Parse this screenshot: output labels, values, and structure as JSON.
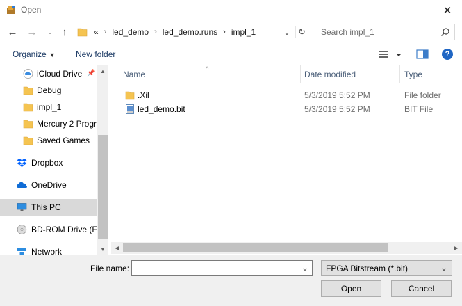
{
  "window": {
    "title": "Open",
    "close_glyph": "✕"
  },
  "nav": {
    "back_glyph": "←",
    "forward_glyph": "→",
    "recent_glyph": "⌄",
    "up_glyph": "↑"
  },
  "address": {
    "overflow": "«",
    "crumbs": [
      "led_demo",
      "led_demo.runs",
      "impl_1"
    ],
    "separator": "›",
    "dropdown_glyph": "⌄",
    "refresh_glyph": "↻"
  },
  "search": {
    "placeholder": "Search impl_1"
  },
  "toolbar": {
    "organize_label": "Organize",
    "organize_caret": "▼",
    "new_folder_label": "New folder",
    "help_glyph": "?"
  },
  "sidebar": {
    "items": [
      {
        "label": "iCloud Drive",
        "icon": "icloud-icon",
        "pinned": true
      },
      {
        "label": "Debug",
        "icon": "folder-icon"
      },
      {
        "label": "impl_1",
        "icon": "folder-icon"
      },
      {
        "label": "Mercury 2 Progr",
        "icon": "folder-icon"
      },
      {
        "label": "Saved Games",
        "icon": "folder-icon"
      },
      {
        "label": "Dropbox",
        "icon": "dropbox-icon"
      },
      {
        "label": "OneDrive",
        "icon": "onedrive-icon"
      },
      {
        "label": "This PC",
        "icon": "this-pc-icon",
        "selected": true
      },
      {
        "label": "BD-ROM Drive (F:",
        "icon": "disc-drive-icon"
      },
      {
        "label": "Network",
        "icon": "network-icon"
      }
    ],
    "pin_glyph": "📌"
  },
  "file_list": {
    "columns": {
      "name": "Name",
      "date": "Date modified",
      "type": "Type"
    },
    "sort_glyph": "^",
    "rows": [
      {
        "name": ".Xil",
        "date": "5/3/2019 5:52 PM",
        "type": "File folder",
        "icon": "folder-icon"
      },
      {
        "name": "led_demo.bit",
        "date": "5/3/2019 5:52 PM",
        "type": "BIT File",
        "icon": "file-icon"
      }
    ]
  },
  "scroll": {
    "up": "▲",
    "down": "▼",
    "left": "◀",
    "right": "▶"
  },
  "footer": {
    "filename_label": "File name:",
    "filename_value": "",
    "dropdown_glyph": "⌄",
    "filetype_value": "FPGA Bitstream (*.bit)",
    "open_label": "Open",
    "cancel_label": "Cancel"
  },
  "colors": {
    "accent": "#1f66c4",
    "folder": "#f5c451",
    "selected_bg": "#d9d9d9",
    "panel_bg": "#f0f0f0"
  }
}
